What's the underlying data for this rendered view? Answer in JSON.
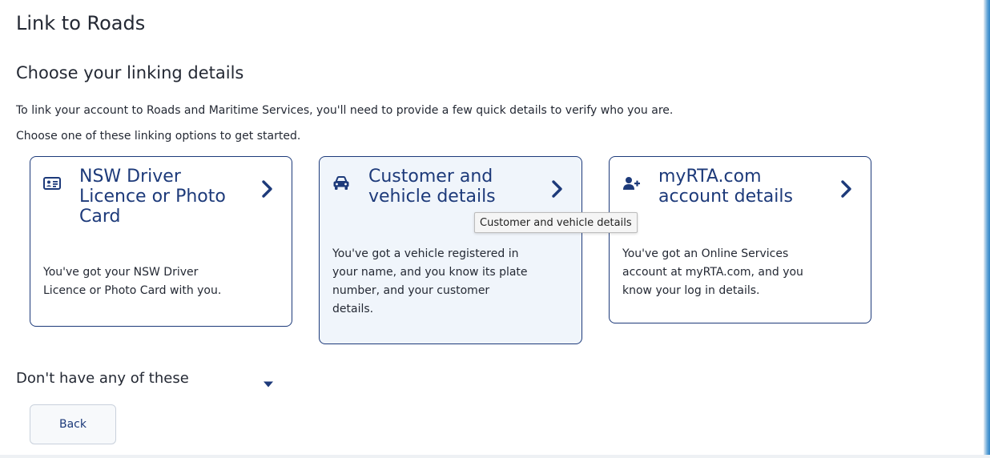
{
  "page": {
    "title": "Link to Roads",
    "section_title": "Choose your linking details",
    "intro_lines": [
      "To link your account to Roads and Maritime Services, you'll need to provide a few quick details to verify who you are.",
      "Choose one of these linking options to get started."
    ]
  },
  "options": [
    {
      "icon": "id-card-icon",
      "title_lines": [
        "NSW Driver",
        "Licence or Photo",
        "Card"
      ],
      "desc_lines": [
        "You've got your NSW Driver",
        "Licence or Photo Card with you."
      ]
    },
    {
      "icon": "car-icon",
      "title_lines": [
        "Customer and",
        "vehicle details"
      ],
      "desc_lines": [
        "You've got a vehicle registered in",
        "your name, and you know its plate",
        "number, and your customer",
        "details."
      ]
    },
    {
      "icon": "add-user-icon",
      "title_lines": [
        "myRTA.com",
        "account details"
      ],
      "desc_lines": [
        "You've got an Online Services",
        "account at myRTA.com, and you",
        "know your log in details."
      ]
    }
  ],
  "tooltip": {
    "text": "Customer and vehicle details"
  },
  "alternatives": {
    "label": "Don't have any of these"
  },
  "actions": {
    "back_label": "Back"
  },
  "colors": {
    "accent": "#1d3a7a",
    "text": "#242934",
    "hover_bg": "#f0f5fb"
  }
}
